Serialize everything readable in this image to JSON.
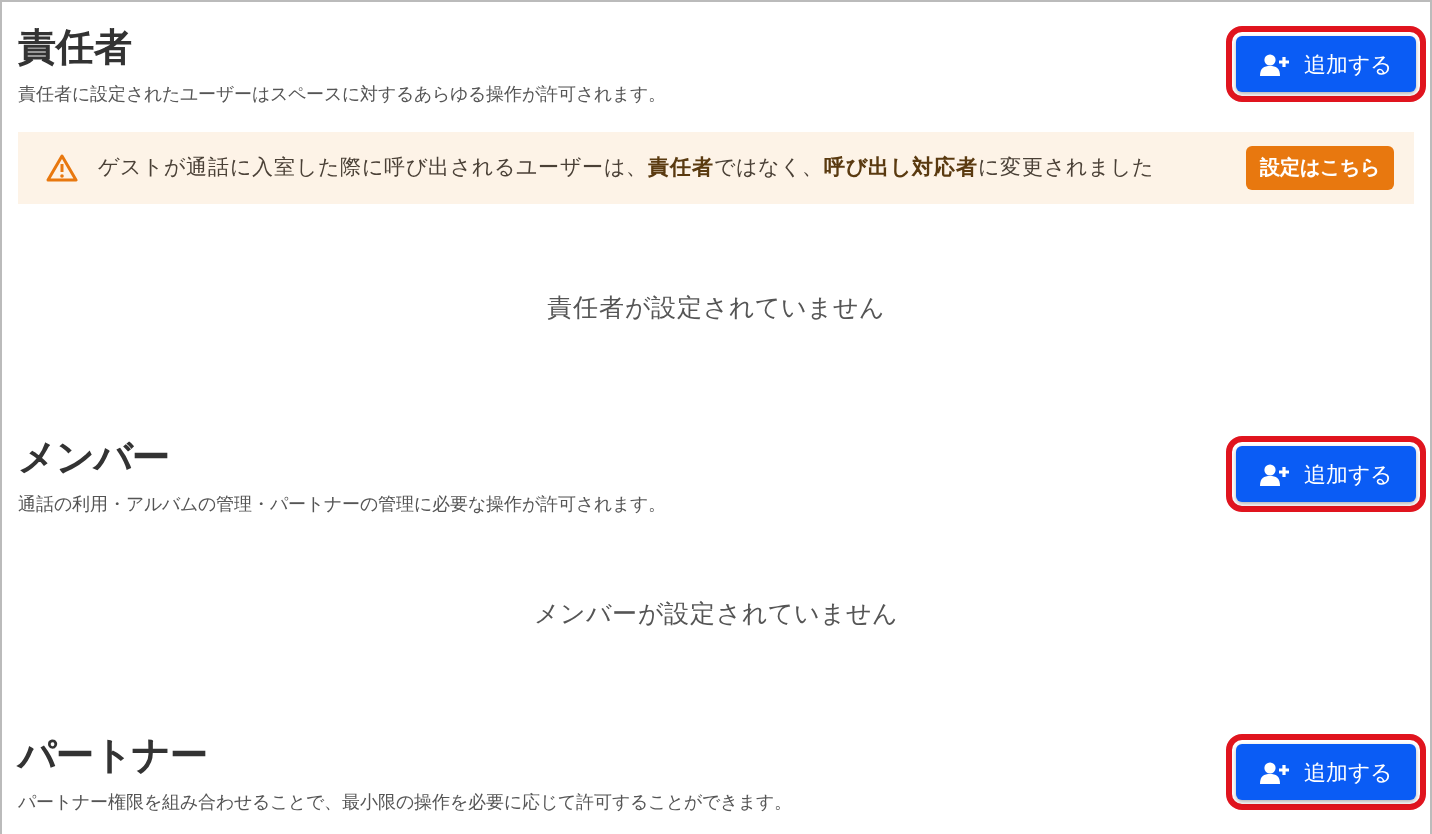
{
  "sections": [
    {
      "title": "責任者",
      "description": "責任者に設定されたユーザーはスペースに対するあらゆる操作が許可されます。",
      "add_button": {
        "label": "追加する",
        "highlighted": true
      },
      "notice": {
        "text": "ゲストが通話に入室した際に呼び出されるユーザーは、**責任者**ではなく、**呼び出し対応者**に変更されました",
        "button": "設定はこちら"
      },
      "empty_message": "責任者が設定されていません"
    },
    {
      "title": "メンバー",
      "description": "通話の利用・アルバムの管理・パートナーの管理に必要な操作が許可されます。",
      "add_button": {
        "label": "追加する",
        "highlighted": true
      },
      "empty_message": "メンバーが設定されていません"
    },
    {
      "title": "パートナー",
      "description": "パートナー権限を組み合わせることで、最小限の操作を必要に応じて許可することができます。",
      "add_button": {
        "label": "追加する",
        "highlighted": true
      }
    }
  ]
}
